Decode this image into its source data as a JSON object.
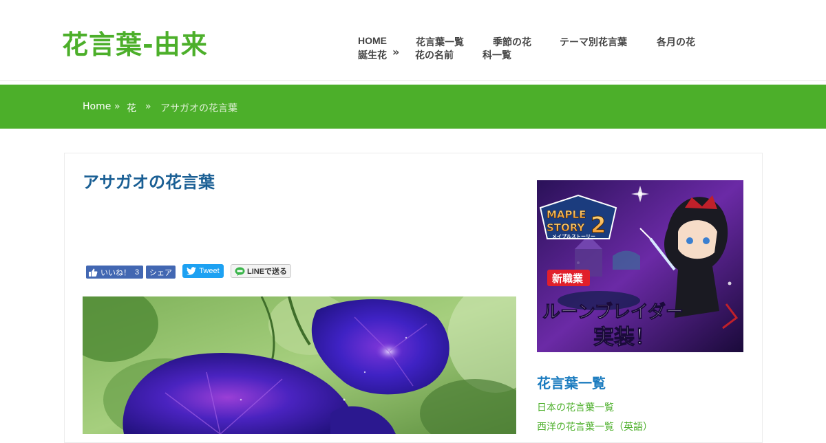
{
  "site": {
    "title": "花言葉-由来"
  },
  "nav": {
    "items": [
      "HOME",
      "花言葉一覧",
      "季節の花",
      "テーマ別花言葉",
      "各月の花",
      "誕生花",
      "花の名前",
      "科一覧"
    ],
    "more_glyph": "»"
  },
  "breadcrumb": {
    "home": "Home",
    "separator": "»",
    "category": "花",
    "current": "アサガオの花言葉"
  },
  "article": {
    "title": "アサガオの花言葉"
  },
  "share": {
    "like_label": "いいね！",
    "like_count": "3",
    "share_label": "シェア",
    "tweet_label": "Tweet",
    "line_label": "LINEで送る"
  },
  "ad": {
    "logo_line1": "MAPLE",
    "logo_line2": "STORY",
    "logo_number": "2",
    "logo_sub": "メイプルストーリー",
    "badge": "新職業",
    "headline": "ルーンブレイダー",
    "subline": "実装！"
  },
  "sidebar": {
    "heading": "花言葉一覧",
    "links": [
      "日本の花言葉一覧",
      "西洋の花言葉一覧（英語）"
    ]
  },
  "colors": {
    "brand_green": "#4caf2a",
    "title_blue": "#1a5f94",
    "sidebar_blue": "#1a7bbf",
    "facebook_blue": "#4267b2",
    "twitter_blue": "#1da1f2"
  },
  "icons": {
    "like": "thumbs-up-icon",
    "tweet": "twitter-bird-icon",
    "line": "line-icon"
  }
}
